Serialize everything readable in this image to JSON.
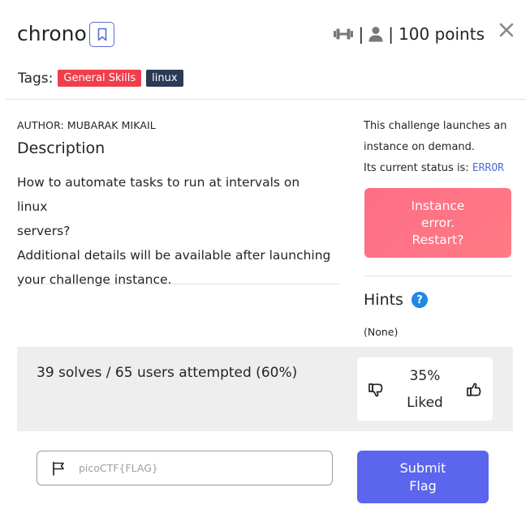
{
  "challenge": {
    "title": "chrono",
    "points_label": "100 points",
    "meta_separator": "|"
  },
  "tags": {
    "label": "Tags:",
    "items": [
      {
        "label": "General Skills",
        "color": "#f03e4b"
      },
      {
        "label": "linux",
        "color": "#2b3a55"
      }
    ]
  },
  "author": "AUTHOR: MUBARAK MIKAIL",
  "description": {
    "title": "Description",
    "lines": [
      "How to automate tasks to run at intervals on linux",
      "servers?",
      "Additional details will be available after launching",
      "your challenge instance."
    ]
  },
  "instance": {
    "line1": "This challenge launches an",
    "line2": "instance on demand.",
    "status_prefix": "Its current status is:",
    "status": "ERROR",
    "restart_lines": [
      "Instance",
      "error.",
      "Restart?"
    ]
  },
  "hints": {
    "title": "Hints",
    "help_glyph": "?",
    "value": "(None)"
  },
  "stats": {
    "solves_text": "39 solves / 65 users attempted (60%)",
    "liked_percent": "35%",
    "liked_label": "Liked"
  },
  "flag": {
    "placeholder": "picoCTF{FLAG}",
    "value": "",
    "submit_lines": [
      "Submit",
      "Flag"
    ]
  },
  "icons": {
    "bookmark": "bookmark-icon",
    "difficulty": "dumbbell-icon",
    "user": "user-icon",
    "close": "close-icon",
    "thumbs_down": "thumbs-down-icon",
    "thumbs_up": "thumbs-up-icon",
    "flag": "flag-icon",
    "help": "question-circle-icon"
  },
  "colors": {
    "accent": "#5b65ee",
    "error_status": "#4f6fd8",
    "restart": "#fd6e86",
    "help": "#1e88e5"
  }
}
